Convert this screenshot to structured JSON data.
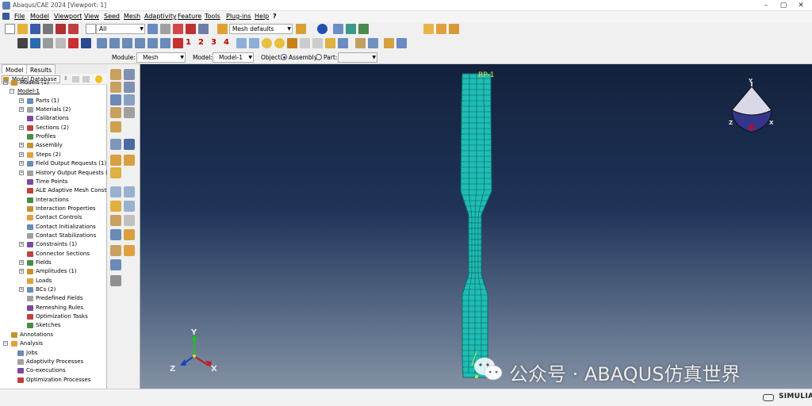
{
  "window": {
    "title": "Abaqus/CAE 2024 [Viewport: 1]",
    "minimize": "–",
    "restore": "▢",
    "close": "✕"
  },
  "menu": [
    {
      "label": "File",
      "key": "menu-file"
    },
    {
      "label": "Model",
      "key": "menu-model"
    },
    {
      "label": "Viewport",
      "key": "menu-viewport"
    },
    {
      "label": "View",
      "key": "menu-view"
    },
    {
      "label": "Seed",
      "key": "menu-seed"
    },
    {
      "label": "Mesh",
      "key": "menu-mesh"
    },
    {
      "label": "Adaptivity",
      "key": "menu-adaptivity"
    },
    {
      "label": "Feature",
      "key": "menu-feature"
    },
    {
      "label": "Tools",
      "key": "menu-tools"
    },
    {
      "label": "Plug-ins",
      "key": "menu-plugins"
    },
    {
      "label": "Help",
      "key": "menu-help"
    },
    {
      "label": "?",
      "key": "menu-whatsthis"
    }
  ],
  "toolbar": {
    "selection_filter": "All",
    "mesh_defaults": "Mesh defaults",
    "view_numbers": [
      "1",
      "2",
      "3",
      "4"
    ]
  },
  "context": {
    "module_label": "Module:",
    "module_value": "Mesh",
    "model_label": "Model:",
    "model_value": "Model-1",
    "object_label": "Object:",
    "assembly_label": "Assembly",
    "part_label": "Part:",
    "part_value": ""
  },
  "left_panel": {
    "tabs": [
      "Model",
      "Results"
    ],
    "database_select": "Model Database",
    "tree": [
      {
        "label": "Models (1)",
        "level": 0,
        "expander": "−",
        "icon": "models-icon"
      },
      {
        "label": "Model-1",
        "level": 1,
        "expander": "−",
        "icon": "",
        "underline": true
      },
      {
        "label": "Parts (1)",
        "level": 2,
        "expander": "+",
        "icon": "parts-icon"
      },
      {
        "label": "Materials (2)",
        "level": 2,
        "expander": "+",
        "icon": "materials-icon"
      },
      {
        "label": "Calibrations",
        "level": 2,
        "expander": "",
        "icon": "calibrations-icon"
      },
      {
        "label": "Sections (2)",
        "level": 2,
        "expander": "+",
        "icon": "sections-icon"
      },
      {
        "label": "Profiles",
        "level": 2,
        "expander": "",
        "icon": "profiles-icon"
      },
      {
        "label": "Assembly",
        "level": 2,
        "expander": "+",
        "icon": "assembly-icon"
      },
      {
        "label": "Steps (2)",
        "level": 2,
        "expander": "+",
        "icon": "steps-icon"
      },
      {
        "label": "Field Output Requests (1)",
        "level": 2,
        "expander": "+",
        "icon": "field-output-icon"
      },
      {
        "label": "History Output Requests (1",
        "level": 2,
        "expander": "+",
        "icon": "history-output-icon"
      },
      {
        "label": "Time Points",
        "level": 2,
        "expander": "",
        "icon": "time-points-icon"
      },
      {
        "label": "ALE Adaptive Mesh Constra",
        "level": 2,
        "expander": "",
        "icon": "ale-mesh-icon"
      },
      {
        "label": "Interactions",
        "level": 2,
        "expander": "",
        "icon": "interactions-icon"
      },
      {
        "label": "Interaction Properties",
        "level": 2,
        "expander": "",
        "icon": "interaction-properties-icon"
      },
      {
        "label": "Contact Controls",
        "level": 2,
        "expander": "",
        "icon": "contact-controls-icon"
      },
      {
        "label": "Contact Initializations",
        "level": 2,
        "expander": "",
        "icon": "contact-init-icon"
      },
      {
        "label": "Contact Stabilizations",
        "level": 2,
        "expander": "",
        "icon": "contact-stab-icon"
      },
      {
        "label": "Constraints (1)",
        "level": 2,
        "expander": "+",
        "icon": "constraints-icon"
      },
      {
        "label": "Connector Sections",
        "level": 2,
        "expander": "",
        "icon": "connector-sections-icon"
      },
      {
        "label": "Fields",
        "level": 2,
        "expander": "+",
        "icon": "fields-icon"
      },
      {
        "label": "Amplitudes (1)",
        "level": 2,
        "expander": "+",
        "icon": "amplitudes-icon"
      },
      {
        "label": "Loads",
        "level": 2,
        "expander": "",
        "icon": "loads-icon"
      },
      {
        "label": "BCs (2)",
        "level": 2,
        "expander": "+",
        "icon": "bcs-icon"
      },
      {
        "label": "Predefined Fields",
        "level": 2,
        "expander": "",
        "icon": "predefined-fields-icon"
      },
      {
        "label": "Remeshing Rules",
        "level": 2,
        "expander": "",
        "icon": "remeshing-rules-icon"
      },
      {
        "label": "Optimization Tasks",
        "level": 2,
        "expander": "",
        "icon": "optimization-tasks-icon"
      },
      {
        "label": "Sketches",
        "level": 2,
        "expander": "",
        "icon": "sketches-icon"
      },
      {
        "label": "Annotations",
        "level": 0,
        "expander": "",
        "icon": "annotations-icon"
      },
      {
        "label": "Analysis",
        "level": 0,
        "expander": "−",
        "icon": "analysis-icon"
      },
      {
        "label": "Jobs",
        "level": 1,
        "expander": "",
        "icon": "jobs-icon"
      },
      {
        "label": "Adaptivity Processes",
        "level": 1,
        "expander": "",
        "icon": "adaptivity-processes-icon"
      },
      {
        "label": "Co-executions",
        "level": 1,
        "expander": "",
        "icon": "co-executions-icon"
      },
      {
        "label": "Optimization Processes",
        "level": 1,
        "expander": "",
        "icon": "optimization-processes-icon"
      }
    ]
  },
  "viewport": {
    "reference_point": "RP-1",
    "triad": {
      "x": "X",
      "y": "Y",
      "z": "Z"
    },
    "view_cube": {
      "x": "X",
      "y": "Y",
      "z": "Z"
    },
    "mesh_color": "#1ebdb5"
  },
  "watermark": "公众号 · ABAQUS仿真世界",
  "brand": "SIMULIA"
}
